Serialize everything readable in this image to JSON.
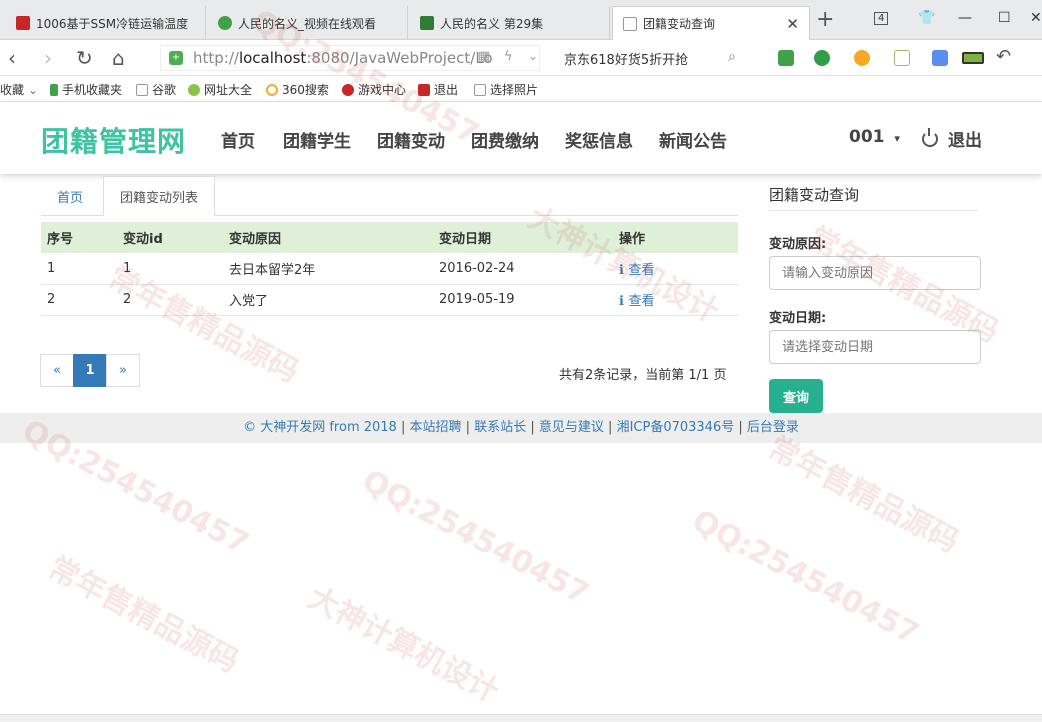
{
  "browser": {
    "tabs": [
      {
        "title": "1006基于SSM冷链运输温度"
      },
      {
        "title": "人民的名义_视频在线观看"
      },
      {
        "title": "人民的名义 第29集"
      },
      {
        "title": "团籍变动查询"
      }
    ],
    "tab_count": "4",
    "url_prefix": "http://",
    "url_host": "localhost",
    "url_rest": ":8080/JavaWebProject/Lo",
    "search_text": "京东618好货5折开抢",
    "bookmarks": [
      "收藏",
      "手机收藏夹",
      "谷歌",
      "网址大全",
      "360搜索",
      "游戏中心",
      "退出",
      "选择照片"
    ]
  },
  "navbar": {
    "brand": "团籍管理网",
    "links": [
      "首页",
      "团籍学生",
      "团籍变动",
      "团费缴纳",
      "奖惩信息",
      "新闻公告"
    ],
    "user": "001",
    "logout": "退出"
  },
  "content": {
    "tabs": [
      "首页",
      "团籍变动列表"
    ],
    "table": {
      "headers": [
        "序号",
        "变动id",
        "变动原因",
        "变动日期",
        "操作"
      ],
      "rows": [
        {
          "index": "1",
          "id": "1",
          "reason": "去日本留学2年",
          "date": "2016-02-24",
          "action": "查看"
        },
        {
          "index": "2",
          "id": "2",
          "reason": "入党了",
          "date": "2019-05-19",
          "action": "查看"
        }
      ]
    },
    "pagination": {
      "prev": "«",
      "current": "1",
      "next": "»",
      "info": "共有2条记录，当前第 1/1 页"
    }
  },
  "sidebar": {
    "title": "团籍变动查询",
    "reason_label": "变动原因:",
    "reason_placeholder": "请输入变动原因",
    "date_label": "变动日期:",
    "date_placeholder": "请选择变动日期",
    "query_button": "查询"
  },
  "footer": {
    "links": [
      "© 大神开发网 from 2018",
      "本站招聘",
      "联系站长",
      "意见与建议",
      "湘ICP备0703346号",
      "后台登录"
    ],
    "separator": "|"
  },
  "watermarks": [
    "QQ:254540457",
    "大神计算机设计",
    "常年售精品源码"
  ],
  "colors": {
    "brand": "#3ec3a3",
    "link": "#337ab7",
    "table_header": "#dff0d8",
    "query_button": "#26b08f"
  }
}
